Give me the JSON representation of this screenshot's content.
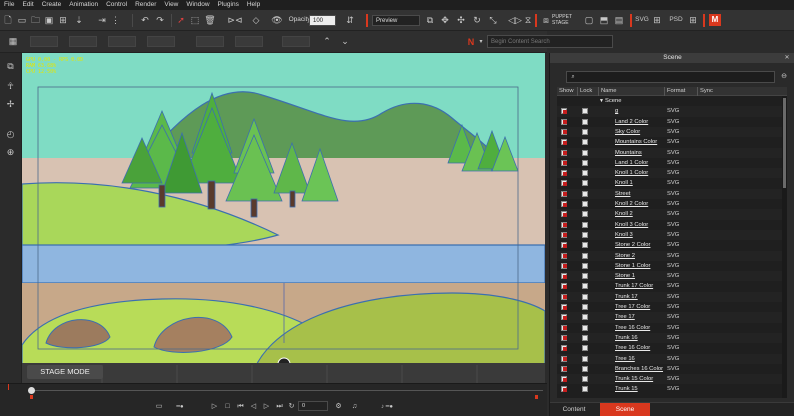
{
  "menu": [
    "File",
    "Edit",
    "Create",
    "Animation",
    "Control",
    "Render",
    "View",
    "Window",
    "Plugins",
    "Help"
  ],
  "toolbar": {
    "opacity_label": "Opacity:",
    "opacity_value": "100",
    "preview_value": "Preview",
    "puppet_label": "PUPPET STAGE",
    "svg_label": "SVG",
    "psd_label": "PSD",
    "search_placeholder": "Begin Content Search"
  },
  "stage": {
    "debug_lines": [
      "GPU 0.00 - RPS 0.0D",
      "RAM 63.68%",
      "CPU 12.50%"
    ],
    "mode_label": "STAGE MODE"
  },
  "timeline": {
    "frame_value": "0"
  },
  "scene_panel": {
    "title": "Scene",
    "columns": [
      "Show",
      "Lock",
      "Name",
      "Format",
      "Sync"
    ],
    "root_label": "Scene",
    "rows": [
      {
        "name": "g",
        "format": "SVG"
      },
      {
        "name": "Land 2 Color",
        "format": "SVG"
      },
      {
        "name": "Sky Color",
        "format": "SVG"
      },
      {
        "name": "Mountains Color",
        "format": "SVG"
      },
      {
        "name": "Mountains",
        "format": "SVG"
      },
      {
        "name": "Land 1 Color",
        "format": "SVG"
      },
      {
        "name": "Knoll 1 Color",
        "format": "SVG"
      },
      {
        "name": "Knoll 1",
        "format": "SVG"
      },
      {
        "name": "Street",
        "format": "SVG"
      },
      {
        "name": "Knoll 2 Color",
        "format": "SVG"
      },
      {
        "name": "Knoll 2",
        "format": "SVG"
      },
      {
        "name": "Knoll 3 Color",
        "format": "SVG"
      },
      {
        "name": "Knoll 3",
        "format": "SVG"
      },
      {
        "name": "Stone 2 Color",
        "format": "SVG"
      },
      {
        "name": "Stone 2",
        "format": "SVG"
      },
      {
        "name": "Stone 1 Color",
        "format": "SVG"
      },
      {
        "name": "Stone 1",
        "format": "SVG"
      },
      {
        "name": "Trunk 17 Color",
        "format": "SVG"
      },
      {
        "name": "Trunk 17",
        "format": "SVG"
      },
      {
        "name": "Tree 17 Color",
        "format": "SVG"
      },
      {
        "name": "Tree 17",
        "format": "SVG"
      },
      {
        "name": "Tree 16 Color",
        "format": "SVG"
      },
      {
        "name": "Trunk 16",
        "format": "SVG"
      },
      {
        "name": "Tree 16 Color",
        "format": "SVG"
      },
      {
        "name": "Tree 16",
        "format": "SVG"
      },
      {
        "name": "Branches 16 Color",
        "format": "SVG"
      },
      {
        "name": "Trunk 15 Color",
        "format": "SVG"
      },
      {
        "name": "Trunk 15",
        "format": "SVG"
      }
    ],
    "tabs": [
      "Content",
      "Scene"
    ],
    "active_tab": "Scene"
  },
  "colors": {
    "accent": "#d9381e"
  }
}
